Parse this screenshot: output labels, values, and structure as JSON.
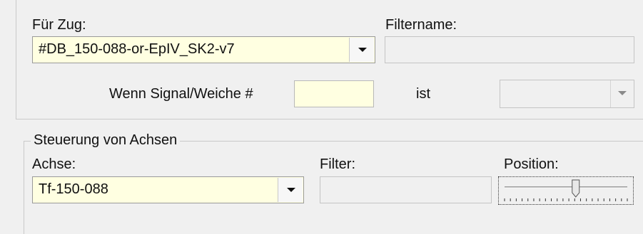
{
  "train_section": {
    "train_label": "Für Zug:",
    "train_value": "#DB_150-088-or-EpIV_SK2-v7",
    "filtername_label": "Filtername:",
    "filtername_value": "",
    "signal_label": "Wenn Signal/Weiche #",
    "signal_value": "",
    "ist_label": "ist",
    "ist_value": ""
  },
  "axes_group": {
    "title": "Steuerung von Achsen",
    "axis_label": "Achse:",
    "axis_value": "Tf-150-088",
    "filter_label": "Filter:",
    "filter_value": "",
    "position_label": "Position:",
    "position_fraction": 0.58
  },
  "icons": {
    "dropdown": "chevron-down-icon"
  }
}
